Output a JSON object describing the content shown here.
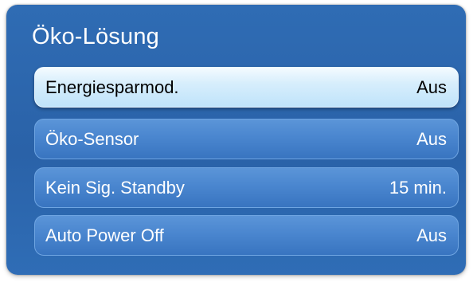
{
  "panel": {
    "title": "Öko-Lösung"
  },
  "menu": {
    "items": [
      {
        "label": "Energiesparmod.",
        "value": "Aus",
        "selected": true
      },
      {
        "label": "Öko-Sensor",
        "value": "Aus",
        "selected": false
      },
      {
        "label": "Kein Sig. Standby",
        "value": "15 min.",
        "selected": false
      },
      {
        "label": "Auto Power Off",
        "value": "Aus",
        "selected": false
      }
    ]
  },
  "colors": {
    "panel_blue": "#2a62a8",
    "item_blue": "#4a86cf",
    "selected_highlight": "#d7eefc"
  }
}
